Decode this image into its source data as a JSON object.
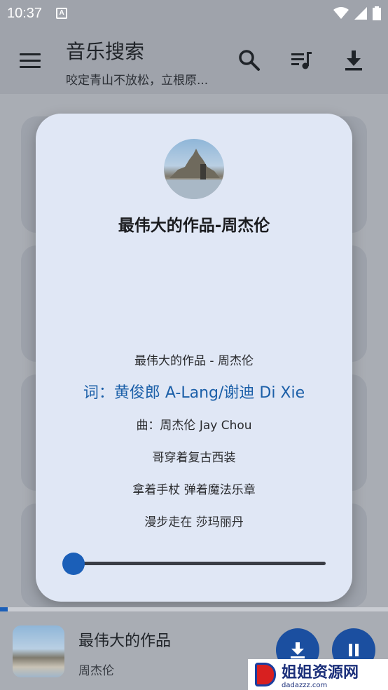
{
  "status_bar": {
    "time": "10:37",
    "notification_icon": "A"
  },
  "app_bar": {
    "title": "音乐搜索",
    "subtitle": "咬定青山不放松，立根原...",
    "icons": [
      "menu-icon",
      "search-icon",
      "queue-music-icon",
      "download-icon"
    ]
  },
  "dialog": {
    "song_heading": "最伟大的作品-周杰伦",
    "lyrics": [
      "最伟大的作品 - 周杰伦",
      "词：黄俊郎 A-Lang/谢迪 Di Xie",
      "曲：周杰伦 Jay Chou",
      "哥穿着复古西装",
      "拿着手杖 弹着魔法乐章",
      "漫步走在 莎玛丽丹"
    ],
    "active_lyric_index": 1,
    "slider_progress": 0.0
  },
  "playback_progress": 0.02,
  "player": {
    "title": "最伟大的作品",
    "artist": "周杰伦"
  },
  "watermark": {
    "text": "姐姐资源网",
    "subtext": "dadazzz.com"
  },
  "colors": {
    "accent": "#1b5fb8",
    "active_lyric": "#1b5fa8",
    "dialog_bg": "#e0e7f5"
  }
}
